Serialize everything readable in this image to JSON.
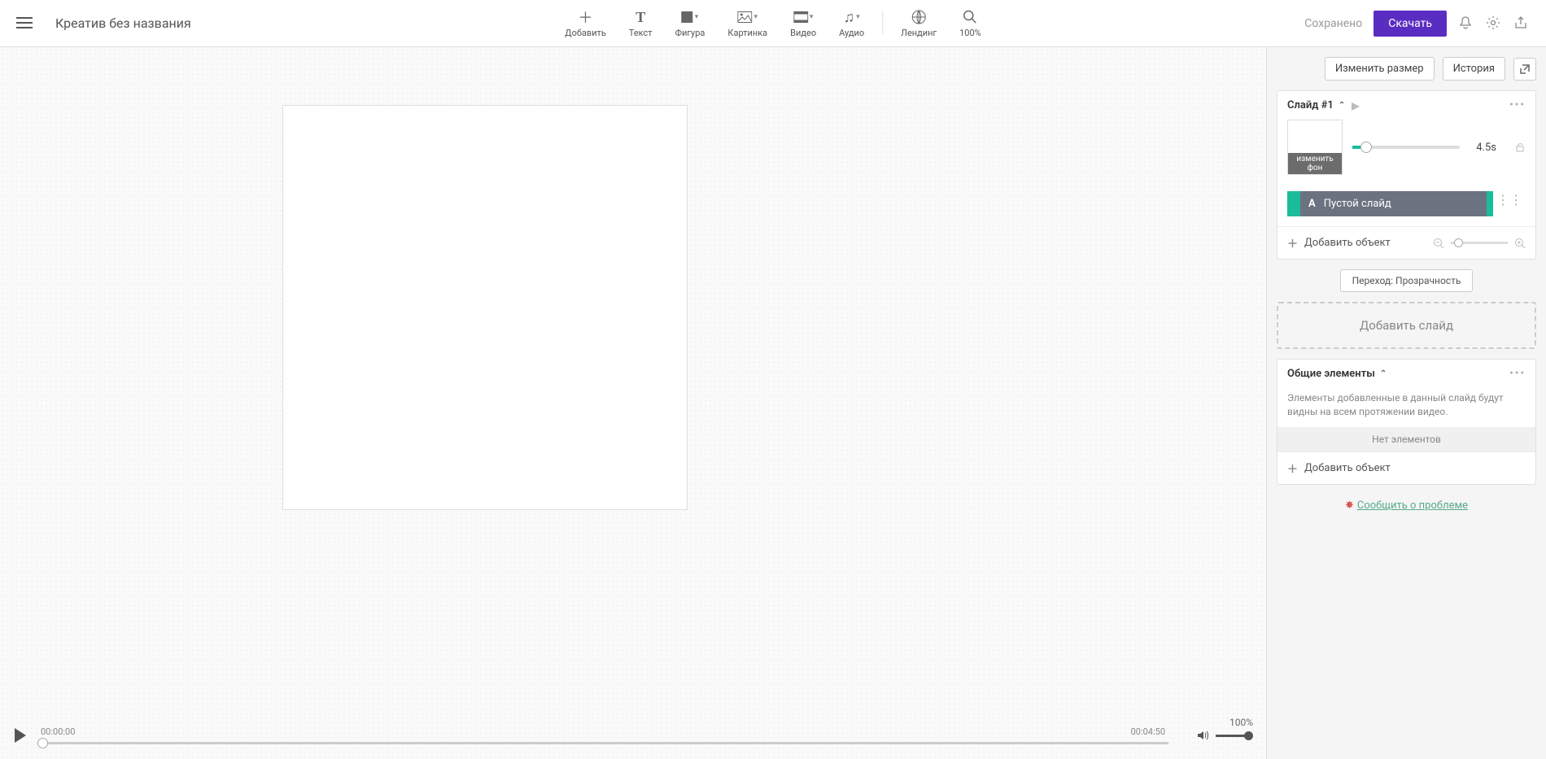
{
  "header": {
    "title": "Креатив без названия",
    "saved": "Сохранено",
    "download": "Скачать"
  },
  "tools": {
    "add": "Добавить",
    "text": "Текст",
    "shape": "Фигура",
    "image": "Картинка",
    "video": "Видео",
    "audio": "Аудио",
    "landing": "Лендинг",
    "zoom": "100%"
  },
  "sidebar_top": {
    "resize": "Изменить размер",
    "history": "История"
  },
  "slide": {
    "title": "Слайд #1",
    "thumb_label": "изменить фон",
    "duration": "4.5s",
    "layer": "Пустой слайд",
    "add_object": "Добавить объект",
    "transition": "Переход: Прозрачность"
  },
  "add_slide": "Добавить слайд",
  "shared": {
    "title": "Общие элементы",
    "desc": "Элементы добавленные в данный слайд будут видны на всем протяжении видео.",
    "empty": "Нет элементов",
    "add_object": "Добавить объект"
  },
  "report": "Сообщить о проблеме",
  "timeline": {
    "start": "00:00:00",
    "end": "00:04:50",
    "volume": "100%"
  }
}
